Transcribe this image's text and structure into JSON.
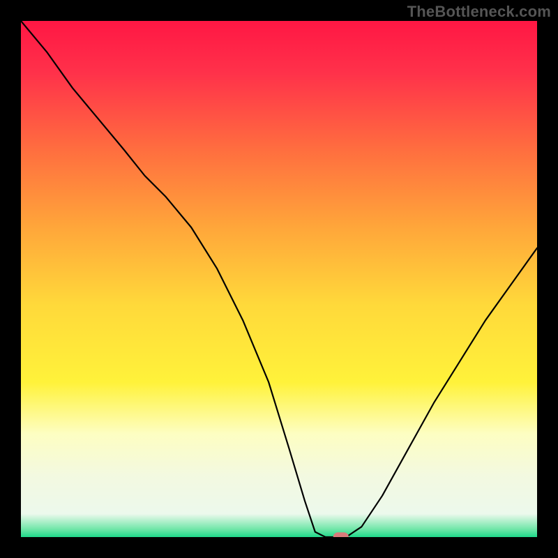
{
  "watermark": "TheBottleneck.com",
  "colors": {
    "frame": "#000000",
    "curve": "#000000",
    "marker": "#d87b7b",
    "gradient_stops": [
      {
        "offset": 0.0,
        "color": "#ff1744"
      },
      {
        "offset": 0.1,
        "color": "#ff314a"
      },
      {
        "offset": 0.25,
        "color": "#ff6e3f"
      },
      {
        "offset": 0.4,
        "color": "#ffa63a"
      },
      {
        "offset": 0.55,
        "color": "#ffd93a"
      },
      {
        "offset": 0.7,
        "color": "#fff23a"
      },
      {
        "offset": 0.8,
        "color": "#fdfec2"
      },
      {
        "offset": 0.88,
        "color": "#f3f9e0"
      },
      {
        "offset": 0.955,
        "color": "#ecf9ec"
      },
      {
        "offset": 0.985,
        "color": "#6fe6a8"
      },
      {
        "offset": 1.0,
        "color": "#1ed98a"
      }
    ]
  },
  "chart_data": {
    "type": "line",
    "title": "",
    "xlabel": "",
    "ylabel": "",
    "xlim": [
      0,
      100
    ],
    "ylim": [
      0,
      100
    ],
    "note": "Heatmap-background bottleneck curve. y = bottleneck magnitude (high at top, 0 at bottom). x = component balance position.",
    "series": [
      {
        "name": "bottleneck-curve",
        "x": [
          0,
          5,
          10,
          15,
          20,
          24,
          28,
          33,
          38,
          43,
          48,
          52,
          55,
          57,
          59,
          61,
          63,
          66,
          70,
          75,
          80,
          85,
          90,
          95,
          100
        ],
        "y": [
          100,
          94,
          87,
          81,
          75,
          70,
          66,
          60,
          52,
          42,
          30,
          17,
          7,
          1,
          0,
          0,
          0,
          2,
          8,
          17,
          26,
          34,
          42,
          49,
          56
        ]
      }
    ],
    "marker": {
      "x": 62,
      "y": 0,
      "w": 3,
      "h": 1.8,
      "rx": 1
    }
  }
}
